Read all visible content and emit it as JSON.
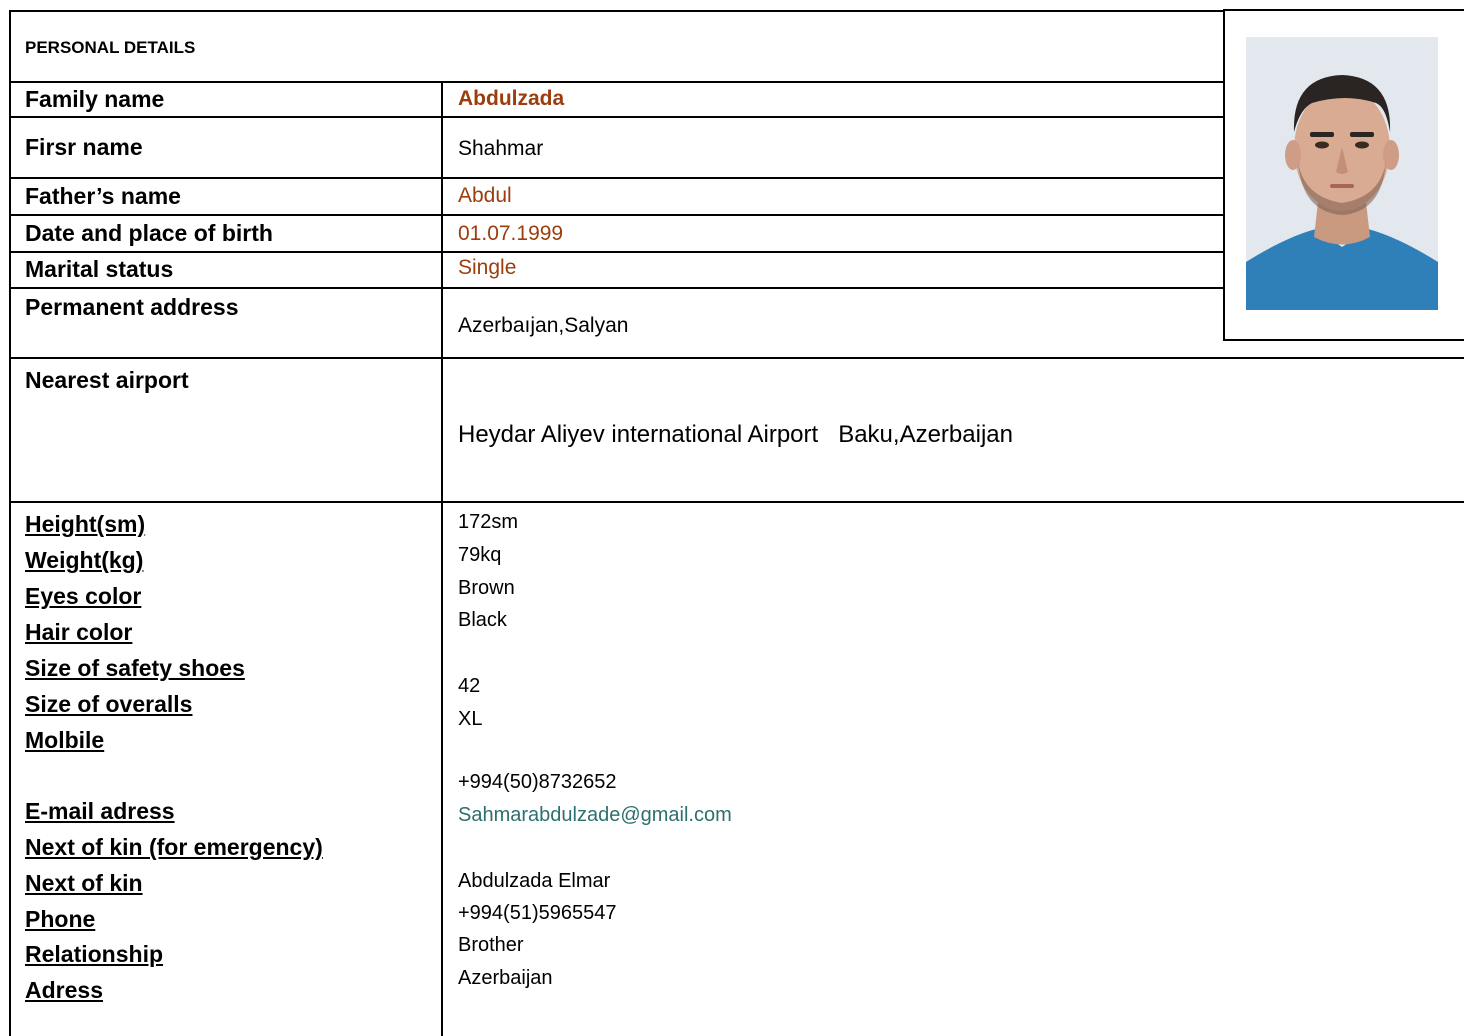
{
  "section_title": "PERSONAL DETAILS",
  "rows": {
    "family_name": {
      "label": "Family name",
      "value": "Abdulzada"
    },
    "first_name": {
      "label": "Firsr name",
      "value": "Shahmar"
    },
    "fathers_name": {
      "label": "Father’s name",
      "value": "Abdul"
    },
    "birth": {
      "label": " Date and place of birth",
      "value": "01.07.1999"
    },
    "marital": {
      "label": "Marital status",
      "value": "Single"
    },
    "address": {
      "label": "Permanent address",
      "value": "Azerbaıjan,Salyan"
    },
    "airport": {
      "label": "Nearest airport",
      "value": "Heydar Aliyev international Airport   Baku,Azerbaijan"
    }
  },
  "details": {
    "labels": [
      "Height(sm)",
      "Weight(kg)",
      "Eyes color",
      "Hair color",
      "Size of safety shoes",
      "Size of overalls",
      "Molbile",
      "E-mail adress",
      "Next of kin (for emergency)",
      "Next of kin",
      "Phone",
      "Relationship",
      "Adress"
    ],
    "height": "172sm",
    "weight": "79kq",
    "eyes": "Brown",
    "hair": "Black",
    "shoes": "42",
    "overalls": "XL",
    "mobile": "+994(50)8732652",
    "email": "Sahmarabdulzade@gmail.com",
    "kin_name": "Abdulzada Elmar",
    "kin_phone": "+994(51)5965547",
    "relationship": "Brother",
    "kin_address": "Azerbaijan"
  },
  "colors": {
    "accent_brown": "#9c3d0e",
    "email_teal": "#2e6f6f",
    "photo_bg": "#dfe6ec",
    "shirt": "#2f7fb5"
  }
}
